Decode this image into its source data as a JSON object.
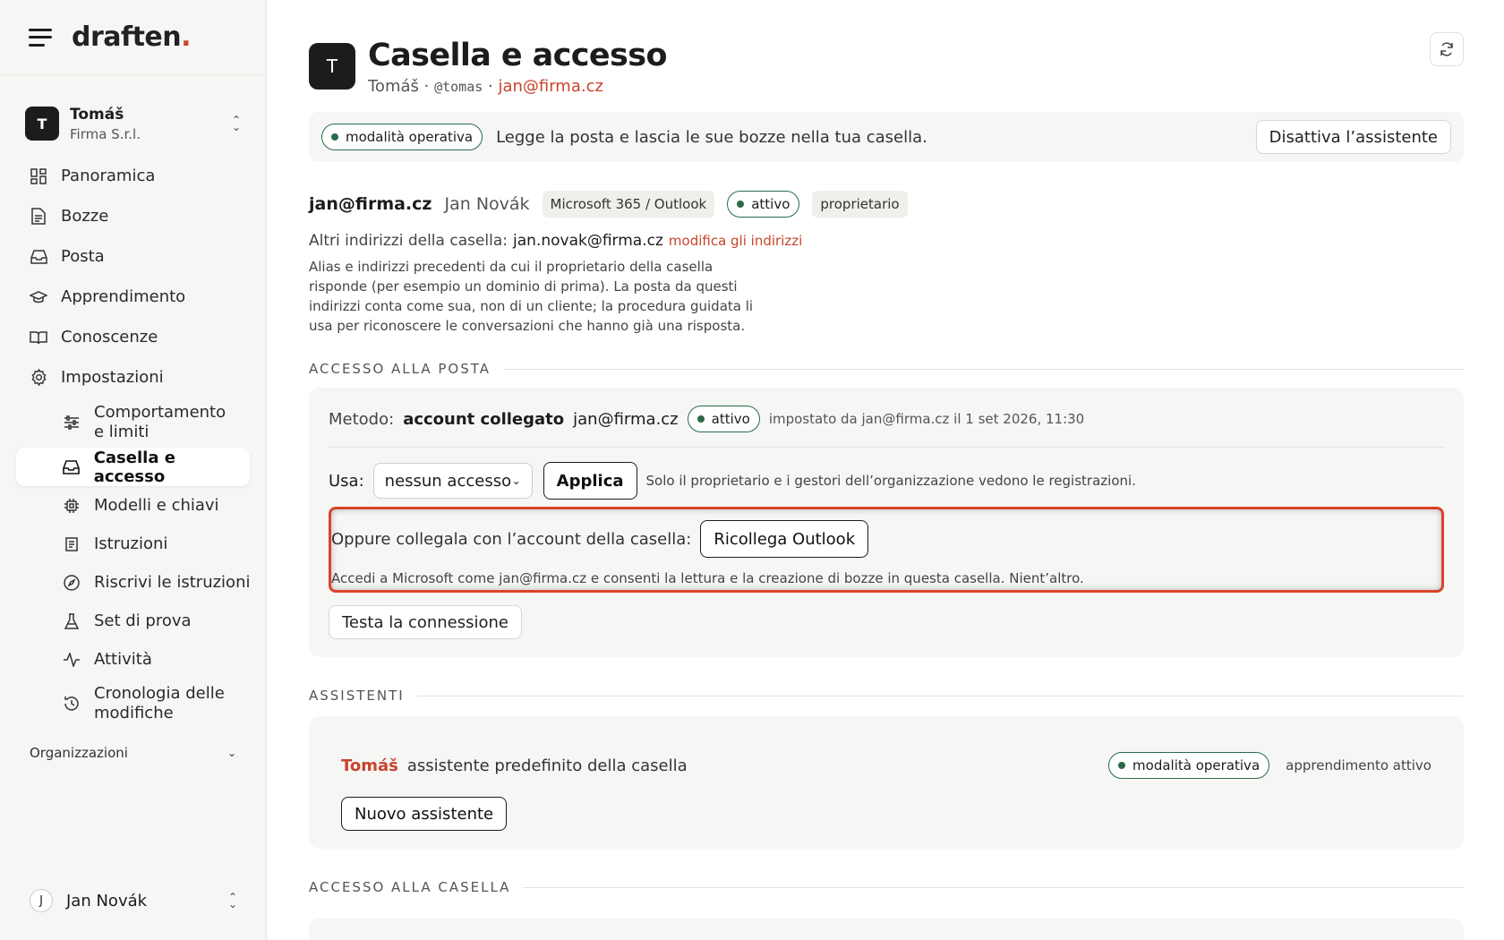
{
  "brand": {
    "name": "draften",
    "dot": "."
  },
  "org": {
    "avatar": "T",
    "name": "Tomáš",
    "company": "Firma S.r.l."
  },
  "nav": [
    {
      "label": "Panoramica",
      "icon": "grid-icon"
    },
    {
      "label": "Bozze",
      "icon": "document-icon"
    },
    {
      "label": "Posta",
      "icon": "inbox-icon"
    },
    {
      "label": "Apprendimento",
      "icon": "graduation-cap-icon"
    },
    {
      "label": "Conoscenze",
      "icon": "book-icon"
    },
    {
      "label": "Impostazioni",
      "icon": "gear-icon"
    }
  ],
  "subnav": [
    {
      "label": "Comportamento e limiti",
      "icon": "sliders-icon"
    },
    {
      "label": "Casella e accesso",
      "icon": "inbox-icon",
      "active": true
    },
    {
      "label": "Modelli e chiavi",
      "icon": "chip-icon"
    },
    {
      "label": "Istruzioni",
      "icon": "list-icon"
    },
    {
      "label": "Riscrivi le istruzioni",
      "icon": "compass-icon"
    },
    {
      "label": "Set di prova",
      "icon": "flask-icon"
    },
    {
      "label": "Attività",
      "icon": "activity-icon"
    },
    {
      "label": "Cronologia delle modifiche",
      "icon": "history-icon"
    }
  ],
  "org_section": "Organizzazioni",
  "user": {
    "avatar": "J",
    "name": "Jan Novák"
  },
  "header": {
    "avatar": "T",
    "title": "Casella e accesso",
    "name": "Tomáš",
    "sep1": " · ",
    "handle": "@tomas",
    "sep2": " · ",
    "email": "jan@firma.cz"
  },
  "mode": {
    "badge": "modalità operativa",
    "description": "Legge la posta e lascia le sue bozze nella tua casella.",
    "disable_button": "Disattiva l’assistente"
  },
  "account": {
    "address": "jan@firma.cz",
    "owner": "Jan Novák",
    "provider": "Microsoft 365 / Outlook",
    "status": "attivo",
    "role": "proprietario",
    "aliases_label": "Altri indirizzi della casella:",
    "alias": "jan.novak@firma.cz",
    "edit_link": "modifica gli indirizzi",
    "help": "Alias e indirizzi precedenti da cui il proprietario della casella risponde (per esempio un dominio di prima). La posta da questi indirizzi conta come sua, non di un cliente; la procedura guidata li usa per riconoscere le conversazioni che hanno già una risposta."
  },
  "mail_access": {
    "heading": "ACCESSO ALLA POSTA",
    "method_label": "Metodo:",
    "method_value": "account collegato",
    "method_email": "jan@firma.cz",
    "method_status": "attivo",
    "method_note": "impostato da jan@firma.cz il 1 set 2026, 11:30",
    "use_label": "Usa:",
    "use_selected": "nessun accesso",
    "apply_button": "Applica",
    "use_note": "Solo il proprietario e i gestori dell’organizzazione vedono le registrazioni.",
    "reconnect_label": "Oppure collegala con l’account della casella:",
    "reconnect_button": "Ricollega Outlook",
    "reconnect_note": "Accedi a Microsoft come jan@firma.cz e consenti la lettura e la creazione di bozze in questa casella. Nient’altro.",
    "test_button": "Testa la connessione"
  },
  "assistants": {
    "heading": "ASSISTENTI",
    "name": "Tomáš",
    "description": "assistente predefinito della casella",
    "badge": "modalità operativa",
    "learning": "apprendimento attivo",
    "new_button": "Nuovo assistente"
  },
  "mailbox_access": {
    "heading": "ACCESSO ALLA CASELLA"
  },
  "colors": {
    "accent": "#c8442b",
    "active_green": "#2a6a4a",
    "highlight": "#d9432a"
  }
}
